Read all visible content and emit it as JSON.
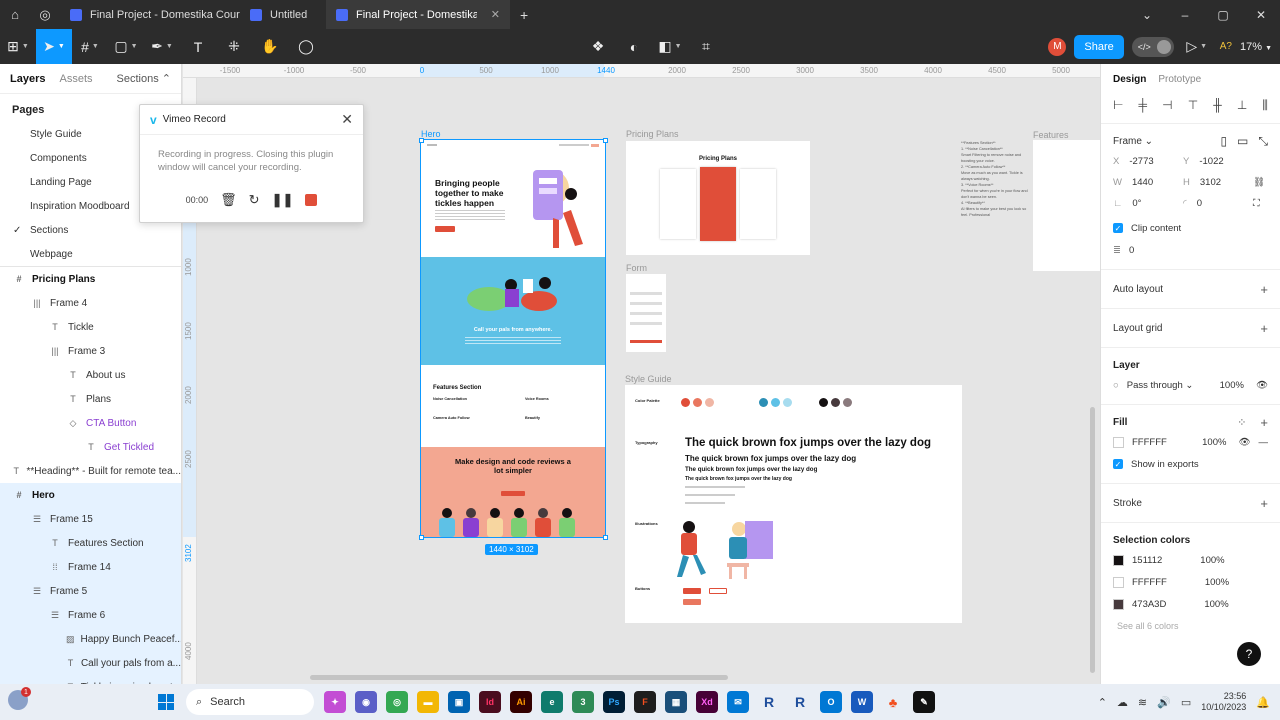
{
  "browser": {
    "tabs": [
      {
        "title": "Final Project - Domestika Course (Co",
        "active": false
      },
      {
        "title": "Untitled",
        "active": false
      },
      {
        "title": "Final Project - Domestika Course (",
        "active": true
      }
    ],
    "plus": "+",
    "controls": {
      "min": "–",
      "max": "▢",
      "close": "✕"
    }
  },
  "toolbar": {
    "user_initial": "M",
    "share_label": "Share",
    "dev_mode": "</>",
    "text_styles": "A?",
    "zoom": "17%"
  },
  "left_panel": {
    "tabs": {
      "layers": "Layers",
      "assets": "Assets",
      "sections": "Sections ⌃"
    },
    "pages_heading": "Pages",
    "pages": [
      {
        "name": "Style Guide",
        "current": false
      },
      {
        "name": "Components",
        "current": false
      },
      {
        "name": "Landing Page",
        "current": false
      },
      {
        "name": "Inspiration Moodboard",
        "current": false
      },
      {
        "name": "Sections",
        "current": true
      },
      {
        "name": "Webpage",
        "current": false
      }
    ],
    "layers": [
      {
        "name": "Pricing Plans",
        "icon": "#",
        "indent": 0,
        "bold": true,
        "selected": false
      },
      {
        "name": "Frame 4",
        "icon": "|||",
        "indent": 1
      },
      {
        "name": "Tickle",
        "icon": "T",
        "indent": 2
      },
      {
        "name": "Frame 3",
        "icon": "|||",
        "indent": 2
      },
      {
        "name": "About us",
        "icon": "T",
        "indent": 3
      },
      {
        "name": "Plans",
        "icon": "T",
        "indent": 3
      },
      {
        "name": "CTA Button",
        "icon": "◇",
        "indent": 3,
        "purple": true
      },
      {
        "name": "Get Tickled",
        "icon": "T",
        "indent": 4,
        "purple": true
      },
      {
        "name": "**Heading** - Built for remote tea...",
        "icon": "T",
        "indent": 0
      },
      {
        "name": "Hero",
        "icon": "#",
        "indent": 0,
        "bold": true,
        "selected": true
      },
      {
        "name": "Frame 15",
        "icon": "☰",
        "indent": 1,
        "selected": true
      },
      {
        "name": "Features Section",
        "icon": "T",
        "indent": 2,
        "selected": true
      },
      {
        "name": "Frame 14",
        "icon": "⁞⁞",
        "indent": 2,
        "selected": true
      },
      {
        "name": "Frame 5",
        "icon": "☰",
        "indent": 1,
        "selected": true
      },
      {
        "name": "Frame 6",
        "icon": "☰",
        "indent": 2,
        "selected": true
      },
      {
        "name": "Happy Bunch Peacef...",
        "icon": "▨",
        "indent": 3,
        "selected": true
      },
      {
        "name": "Call your pals from a...",
        "icon": "T",
        "indent": 3,
        "selected": true
      },
      {
        "name": "Tickle is a simple yet...",
        "icon": "T",
        "indent": 3,
        "selected": true
      }
    ]
  },
  "rulers": {
    "top": [
      "-1500",
      "-1000",
      "-500",
      "0",
      "500",
      "1000",
      "1440",
      "2000",
      "2500",
      "3000",
      "3500",
      "4000",
      "4500",
      "5000"
    ],
    "left": [
      "1000",
      "1500",
      "2000",
      "2500",
      "3102",
      "4000"
    ]
  },
  "canvas": {
    "hero_label": "Hero",
    "size_badge": "1440 × 3102",
    "pricing_label": "Pricing Plans",
    "pricing_title": "Pricing Plans",
    "form_label": "Form",
    "style_guide_label": "Style Guide",
    "features_label": "Features",
    "hero_title": "Bringing people together to make tickles happen",
    "hero_call": "Call your pals from anywhere.",
    "features_heading": "Features Section",
    "features_items": [
      "Noise Cancellation",
      "Voice Rooms",
      "Camera Auto Follow",
      "Beautify"
    ],
    "review_heading": "Make design and code reviews a lot simpler",
    "sg_labels": {
      "color": "Color Palette",
      "typography": "Typography",
      "illustrations": "Illustrations",
      "buttons": "Buttons"
    },
    "typo_samples": [
      "The quick brown fox jumps over the lazy dog",
      "The quick brown fox jumps over the lazy dog",
      "The quick brown fox jumps over the lazy dog",
      "The quick brown fox jumps over the lazy dog"
    ],
    "notes": [
      "**Features Section**",
      "1. **Noise Cancellation**",
      "Smart Filtering to remove noise and boosting your voice.",
      "2. **Camera Auto Follow**",
      "Move as much as you want. Tickle is always watching.",
      "3. **Voice Rooms**",
      "Perfect for when you're in your flow and don't wanna be seen.",
      "4. **Beautify**",
      "AI filters to make your best you look so feel. Professional"
    ],
    "palette": [
      "#e04e39",
      "#e9775f",
      "#f0b6a5",
      "#2c8fb5",
      "#5ec1e6",
      "#a7dcef",
      "#151112",
      "#473A3D",
      "#8a7a7d"
    ]
  },
  "plugin": {
    "title": "Vimeo Record",
    "message": "Recording in progress. Closing this plugin window will cancel your recording.",
    "timer": "00:00"
  },
  "right_panel": {
    "tabs": {
      "design": "Design",
      "prototype": "Prototype"
    },
    "frame_label": "Frame ⌄",
    "x_label": "X",
    "x": "-2773",
    "y_label": "Y",
    "y": "-1022",
    "w_label": "W",
    "w": "1440",
    "h_label": "H",
    "h": "3102",
    "rotation": "0°",
    "radius": "0",
    "clip_content": "Clip content",
    "spacing": "0",
    "auto_layout": "Auto layout",
    "layout_grid": "Layout grid",
    "layer_heading": "Layer",
    "blend": "Pass through ⌄",
    "layer_opacity": "100%",
    "fill_heading": "Fill",
    "fill_hex": "FFFFFF",
    "fill_opacity": "100%",
    "show_exports": "Show in exports",
    "stroke_heading": "Stroke",
    "selection_colors_heading": "Selection colors",
    "selection_colors": [
      {
        "hex": "151112",
        "opacity": "100%",
        "color": "#151112"
      },
      {
        "hex": "FFFFFF",
        "opacity": "100%",
        "color": "#FFFFFF"
      },
      {
        "hex": "473A3D",
        "opacity": "100%",
        "color": "#473A3D"
      }
    ],
    "see_all": "See all 6 colors"
  },
  "taskbar": {
    "search": "Search",
    "time": "23:56",
    "date": "10/10/2023",
    "notification_count": "1",
    "help": "?"
  },
  "colors": {
    "accent": "#0d99ff",
    "record": "#e04e39",
    "toolbar": "#2c2c2c"
  }
}
